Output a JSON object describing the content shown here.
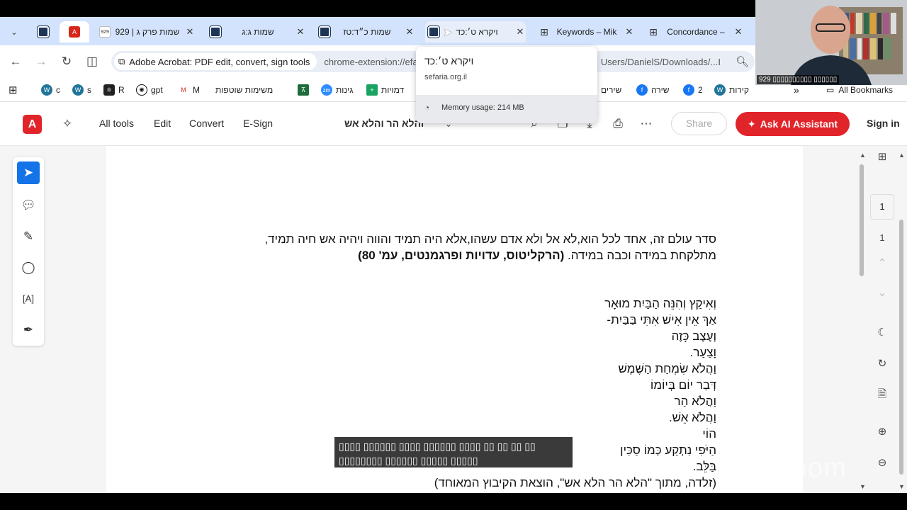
{
  "browser": {
    "tabs": [
      {
        "title": "",
        "icon": "sefaria-icon"
      },
      {
        "title": "",
        "icon": "acrobat-icon",
        "active": true
      },
      {
        "title": "שמות פרק ג | 929",
        "icon": "929-icon"
      },
      {
        "title": "שמות ג:ג",
        "icon": "sefaria-icon"
      },
      {
        "title": "שמות כ״ד:טז",
        "icon": "sefaria-icon"
      },
      {
        "title": "ויקרא ט׳:כד",
        "icon": "sefaria-icon"
      },
      {
        "title": "Keywords – Mik",
        "icon": "film-icon"
      },
      {
        "title": "Concordance –",
        "icon": "film-icon"
      }
    ],
    "tab_badge_929": "929",
    "site_chip": "Adobe Acrobat: PDF edit, convert, sign tools",
    "url_left": "chrome-extension://efa",
    "url_right": "Users/DanielS/Downloads/...I",
    "bookmarks": [
      {
        "label": "c",
        "icon": "wordpress-icon"
      },
      {
        "label": "s",
        "icon": "wordpress-icon"
      },
      {
        "label": "R",
        "icon": "react-icon"
      },
      {
        "label": "gpt",
        "icon": "openai-icon"
      },
      {
        "label": "M",
        "icon": "gmail-icon"
      },
      {
        "label": "משימות שוטפות",
        "icon": ""
      },
      {
        "label": "",
        "icon": "sheet-icon"
      },
      {
        "label": "גינות",
        "icon": "zoom-icon"
      },
      {
        "label": "דמויות",
        "icon": "plus-icon"
      },
      {
        "label": "שירים",
        "icon": ""
      },
      {
        "label": "שירה",
        "icon": "facebook-icon"
      },
      {
        "label": "2",
        "icon": "facebook-icon"
      },
      {
        "label": "קירות",
        "icon": "wordpress-icon"
      }
    ],
    "bookmarks_more": "»",
    "all_bookmarks": "All Bookmarks",
    "tooltip": {
      "title": "ויקרא ט׳:כד",
      "domain": "sefaria.org.il",
      "memory": "Memory usage: 214 MB"
    }
  },
  "acrobat": {
    "menu": [
      "All tools",
      "Edit",
      "Convert",
      "E-Sign"
    ],
    "doc_title": "והלא הר והלא אש",
    "share_label": "Share",
    "ask_ai_label": "Ask AI Assistant",
    "signin_label": "Sign in",
    "page_number": "1",
    "page_total": "1"
  },
  "document": {
    "heraclitus_line1": "סדר עולם זה, אחד לכל הוא,לא אל ולא אדם עשהו,אלא היה תמיד והווה ויהיה אש חיה תמיד,",
    "heraclitus_line2_plain": "מתלקחת במידה וכבה במידה. ",
    "heraclitus_line2_bold": "(הרקליטוס, עדויות ופרגמנטים, עמ' 80)",
    "poem": [
      "וְאִיקַץ וְהִנֵּה הַבַּיִת מוּאָר",
      "אַךְ אֵין אִישׁ אִתִּי בַּבַּיִת-",
      "וְעֶצֶב כָּזֶה",
      "וָצַעַר.",
      "וַהֲלֹא שִׂמְחַת הַשֶּׁמֶשׁ",
      "דְּבַר יוֹם בְּיוֹמוֹ",
      "וַהֲלֹא הַר",
      "וַהֲלֹא אֵשׁ.",
      "הוֹי",
      "הַיֹּפִי נִתְקַע כְּמוֹ סַכִּין",
      "בַּלֵּב."
    ],
    "source": "(זלדה, מתוך \"הלא הר הלא אש\", הוצאת הקיבוץ המאוחד)"
  },
  "zoom": {
    "participant_label": "929 ▯▯▯▯▯▯▯▯▯▯ ▯▯▯▯▯▯",
    "caption_line1": "▯▯▯▯ ▯▯▯▯▯▯ ▯▯▯▯ ▯▯▯▯▯▯ ▯▯▯▯ ▯▯ ▯▯ ▯▯ ▯▯",
    "caption_line2": "▯▯▯▯▯▯▯▯ ▯▯▯▯▯▯ ▯▯▯▯▯ ▯▯▯▯▯",
    "watermark": "zoom"
  }
}
